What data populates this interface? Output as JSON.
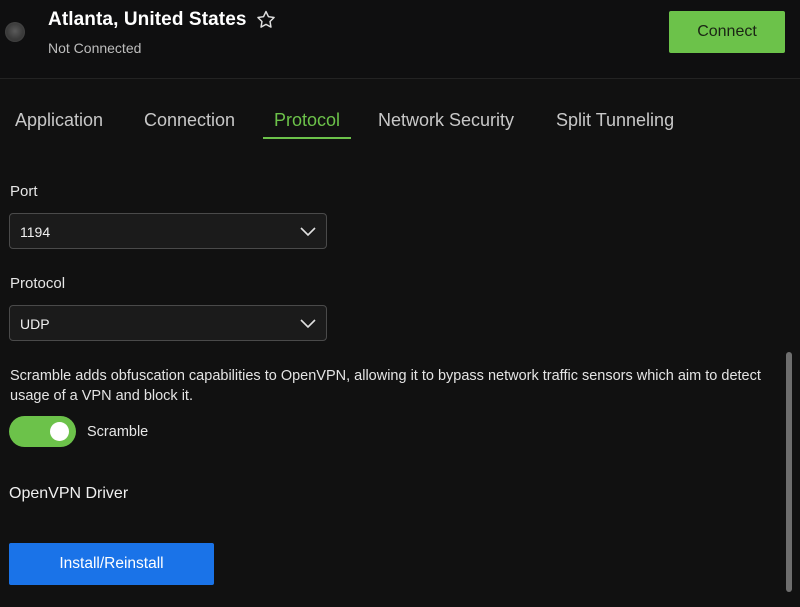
{
  "header": {
    "location": "Atlanta, United States",
    "status": "Not Connected",
    "connect_label": "Connect",
    "favorite_icon": "star-outline-icon",
    "status_indicator_icon": "status-dot-icon"
  },
  "tabs": [
    {
      "label": "Application",
      "active": false
    },
    {
      "label": "Connection",
      "active": false
    },
    {
      "label": "Protocol",
      "active": true
    },
    {
      "label": "Network Security",
      "active": false
    },
    {
      "label": "Split Tunneling",
      "active": false
    }
  ],
  "protocol_settings": {
    "port": {
      "label": "Port",
      "value": "1194"
    },
    "protocol": {
      "label": "Protocol",
      "value": "UDP"
    },
    "scramble": {
      "description": "Scramble adds obfuscation capabilities to OpenVPN, allowing it to bypass network traffic sensors which aim to detect usage of a VPN and block it.",
      "toggle_label": "Scramble",
      "enabled": true
    },
    "driver": {
      "heading": "OpenVPN Driver",
      "button_label": "Install/Reinstall"
    }
  },
  "colors": {
    "accent_green": "#6cc24a",
    "primary_blue": "#1a73e8",
    "background": "#111111"
  }
}
